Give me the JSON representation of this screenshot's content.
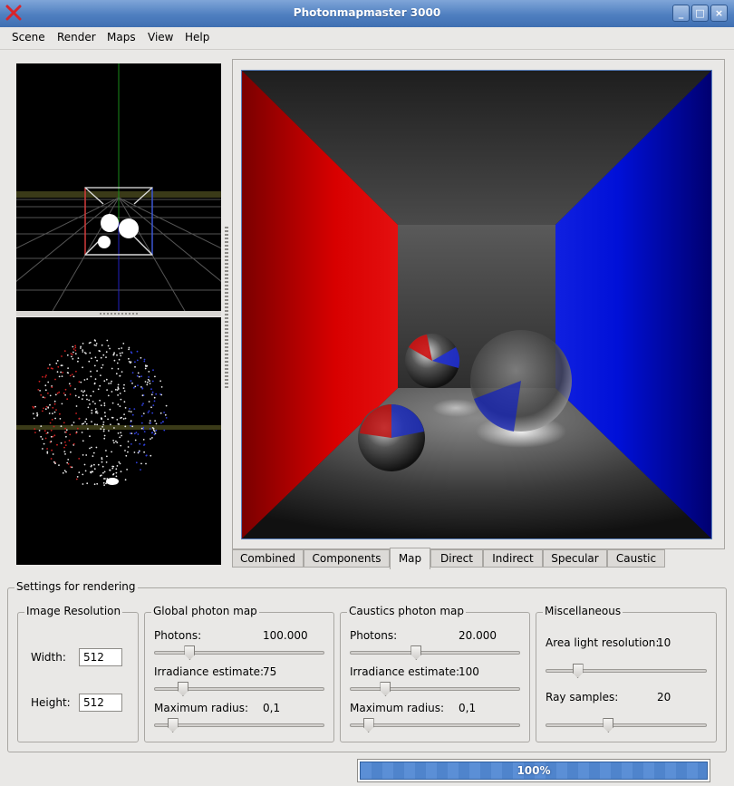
{
  "window": {
    "title": "Photonmapmaster 3000",
    "minimize": "_",
    "maximize": "□",
    "close": "×"
  },
  "menu": [
    "Scene",
    "Render",
    "Maps",
    "View",
    "Help"
  ],
  "tabs": [
    "Combined",
    "Components",
    "Map",
    "Direct",
    "Indirect",
    "Specular",
    "Caustic"
  ],
  "active_tab": "Map",
  "settings": {
    "title": "Settings for rendering",
    "image_resolution": {
      "title": "Image Resolution",
      "width_label": "Width:",
      "width_value": "512",
      "height_label": "Height:",
      "height_value": "512"
    },
    "global_map": {
      "title": "Global photon map",
      "photons_label": "Photons:",
      "photons_value": "100.000",
      "photons_level": 0.21,
      "irradiance_label": "Irradiance estimate:",
      "irradiance_value": "75",
      "irradiance_level": 0.17,
      "radius_label": "Maximum radius:",
      "radius_value": "0,1",
      "radius_level": 0.11
    },
    "caustics_map": {
      "title": "Caustics photon map",
      "photons_label": "Photons:",
      "photons_value": "20.000",
      "photons_level": 0.39,
      "irradiance_label": "Irradiance estimate:",
      "irradiance_value": "100",
      "irradiance_level": 0.21,
      "radius_label": "Maximum radius:",
      "radius_value": "0,1",
      "radius_level": 0.11
    },
    "misc": {
      "title": "Miscellaneous",
      "area_label": "Area light resolution:",
      "area_value": "10",
      "area_level": 0.2,
      "ray_label": "Ray samples:",
      "ray_value": "20",
      "ray_level": 0.39
    }
  },
  "progress": {
    "text": "100%",
    "fraction": 1.0
  },
  "colors": {
    "title_bar": "#4f7fc0",
    "red_wall": "#d40000",
    "blue_wall": "#0010d0",
    "progress": "#5b8fd6"
  }
}
